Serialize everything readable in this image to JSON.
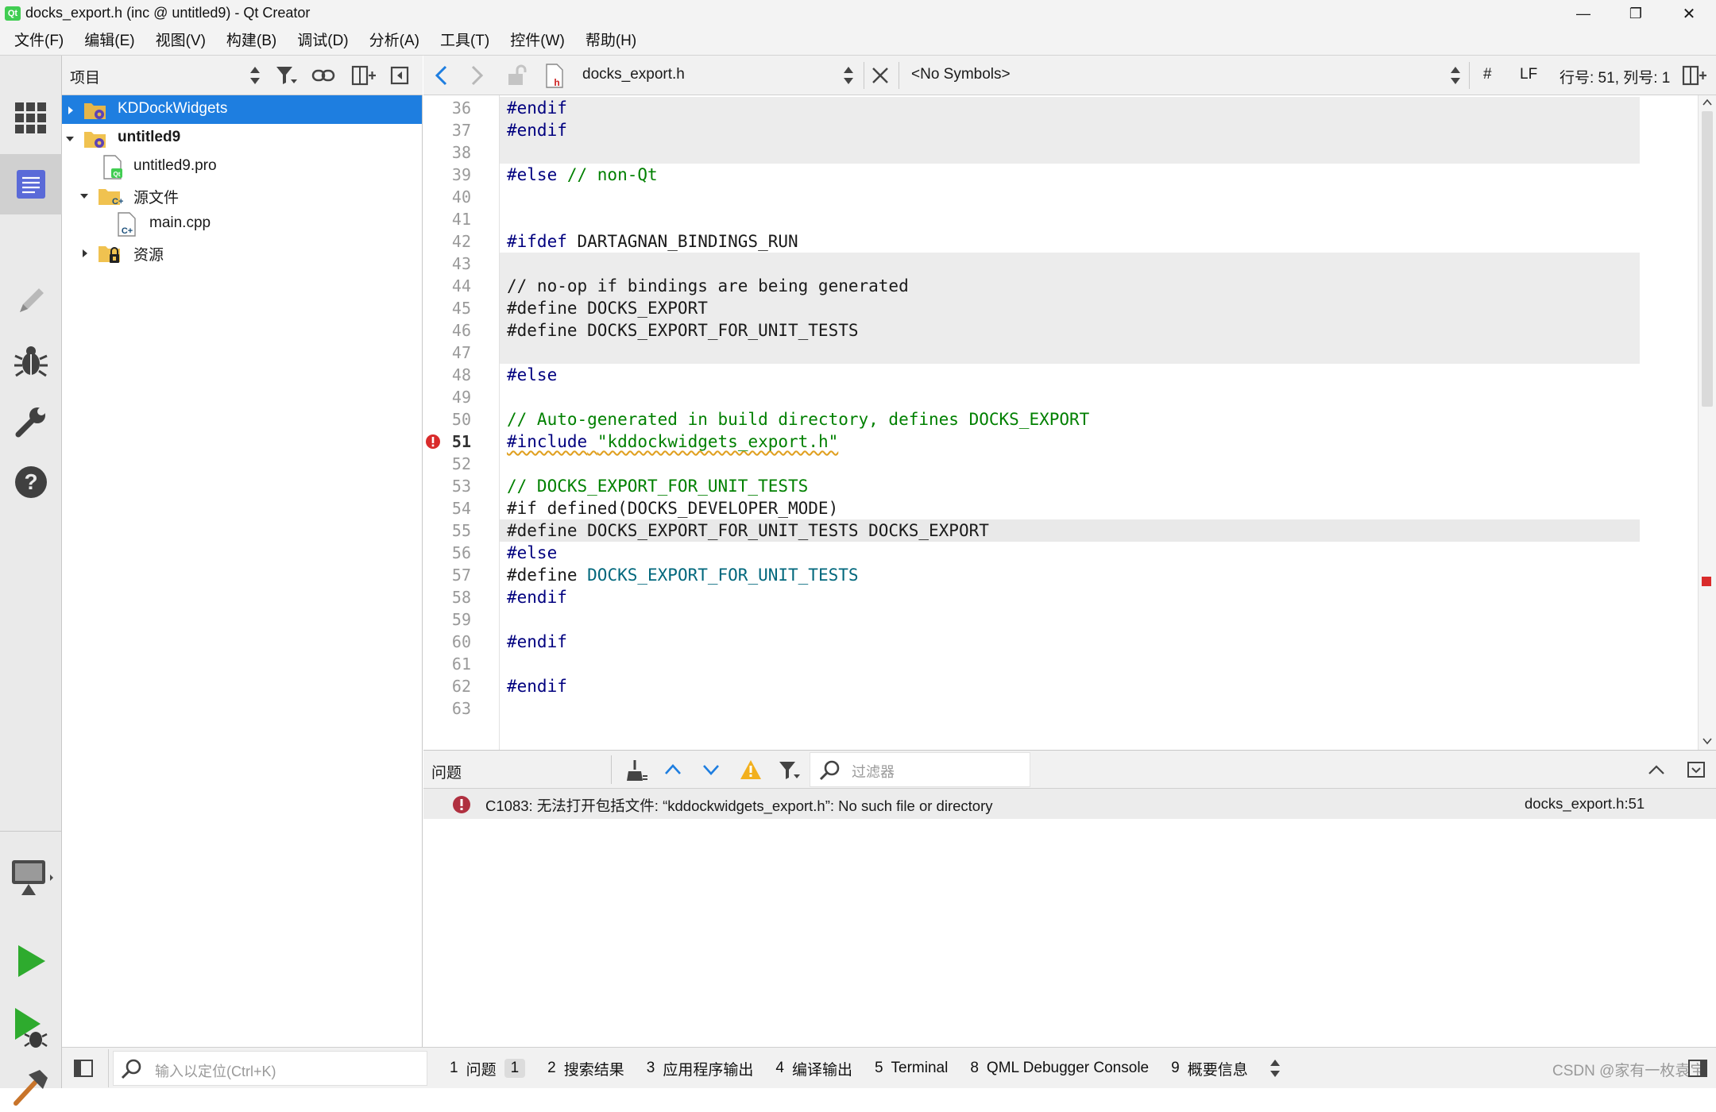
{
  "window": {
    "title": "docks_export.h (inc @ untitled9) - Qt Creator",
    "controls": {
      "minimize": "—",
      "maximize": "❐",
      "close": "✕"
    }
  },
  "menu": [
    "文件(F)",
    "编辑(E)",
    "视图(V)",
    "构建(B)",
    "调试(D)",
    "分析(A)",
    "工具(T)",
    "控件(W)",
    "帮助(H)"
  ],
  "modes": [
    "welcome-icon",
    "edit-icon",
    "design-icon",
    "debug-icon",
    "projects-icon",
    "help-icon"
  ],
  "run_controls": [
    "target-monitor-icon",
    "run-icon",
    "debug-run-icon",
    "build-hammer-icon"
  ],
  "project_pane": {
    "title": "项目",
    "tree": [
      {
        "label": "KDDockWidgets",
        "icon": "project-folder-icon",
        "expanded": false,
        "selected": true,
        "bold": false
      },
      {
        "label": "untitled9",
        "icon": "project-folder-icon",
        "expanded": true,
        "selected": false,
        "bold": true
      },
      {
        "label": "untitled9.pro",
        "icon": "pro-file-icon"
      },
      {
        "label": "源文件",
        "icon": "source-folder-icon",
        "expanded": true
      },
      {
        "label": "main.cpp",
        "icon": "cpp-file-icon"
      },
      {
        "label": "资源",
        "icon": "resource-folder-icon",
        "expanded": false
      }
    ]
  },
  "editor_toolbar": {
    "file_name": "docks_export.h",
    "symbols": "<No Symbols>",
    "hash": "#",
    "line_ending": "LF",
    "position": "行号: 51, 列号: 1"
  },
  "code_lines": [
    {
      "n": "36",
      "text": "#endif",
      "kind": "pp",
      "bg": "grey"
    },
    {
      "n": "37",
      "text": "#endif",
      "kind": "pp",
      "bg": "grey"
    },
    {
      "n": "38",
      "text": "",
      "kind": "plain",
      "bg": "grey"
    },
    {
      "n": "39",
      "text": "#else // non-Qt",
      "kind": "else-comment",
      "bg": "white"
    },
    {
      "n": "40",
      "text": "",
      "kind": "plain",
      "bg": "white"
    },
    {
      "n": "41",
      "text": "",
      "kind": "plain",
      "bg": "white"
    },
    {
      "n": "42",
      "text": "#ifdef DARTAGNAN_BINDINGS_RUN",
      "kind": "pp-mixed",
      "bg": "white"
    },
    {
      "n": "43",
      "text": "",
      "kind": "plain",
      "bg": "grey"
    },
    {
      "n": "44",
      "text": "// no-op if bindings are being generated",
      "kind": "plain",
      "bg": "grey"
    },
    {
      "n": "45",
      "text": "#define DOCKS_EXPORT",
      "kind": "plain",
      "bg": "grey"
    },
    {
      "n": "46",
      "text": "#define DOCKS_EXPORT_FOR_UNIT_TESTS",
      "kind": "plain",
      "bg": "grey"
    },
    {
      "n": "47",
      "text": "",
      "kind": "plain",
      "bg": "grey"
    },
    {
      "n": "48",
      "text": "#else",
      "kind": "pp",
      "bg": "white"
    },
    {
      "n": "49",
      "text": "",
      "kind": "plain",
      "bg": "white"
    },
    {
      "n": "50",
      "text": "// Auto-generated in build directory, defines DOCKS_EXPORT",
      "kind": "comment",
      "bg": "white"
    },
    {
      "n": "51",
      "text": "#include \"kddockwidgets_export.h\"",
      "kind": "include",
      "bg": "white",
      "error": true
    },
    {
      "n": "52",
      "text": "",
      "kind": "plain",
      "bg": "white"
    },
    {
      "n": "53",
      "text": "// DOCKS_EXPORT_FOR_UNIT_TESTS",
      "kind": "comment",
      "bg": "white"
    },
    {
      "n": "54",
      "text": "#if defined(DOCKS_DEVELOPER_MODE)",
      "kind": "plain",
      "bg": "white"
    },
    {
      "n": "55",
      "text": "#define DOCKS_EXPORT_FOR_UNIT_TESTS DOCKS_EXPORT",
      "kind": "plain",
      "bg": "current"
    },
    {
      "n": "56",
      "text": "#else",
      "kind": "pp",
      "bg": "white"
    },
    {
      "n": "57",
      "text": "#define DOCKS_EXPORT_FOR_UNIT_TESTS",
      "kind": "define-macro",
      "bg": "white"
    },
    {
      "n": "58",
      "text": "#endif",
      "kind": "pp",
      "bg": "white"
    },
    {
      "n": "59",
      "text": "",
      "kind": "plain",
      "bg": "white"
    },
    {
      "n": "60",
      "text": "#endif",
      "kind": "pp",
      "bg": "white"
    },
    {
      "n": "61",
      "text": "",
      "kind": "plain",
      "bg": "white"
    },
    {
      "n": "62",
      "text": "#endif",
      "kind": "pp",
      "bg": "white"
    },
    {
      "n": "63",
      "text": "",
      "kind": "plain",
      "bg": "white"
    }
  ],
  "issues_pane": {
    "title": "问题",
    "filter_placeholder": "过滤器",
    "items": [
      {
        "message": "C1083: 无法打开包括文件: “kddockwidgets_export.h”: No such file or directory",
        "location": "docks_export.h:51"
      }
    ]
  },
  "bottom_bar": {
    "locator_placeholder": "输入以定位(Ctrl+K)",
    "tabs": [
      {
        "num": "1",
        "label": "问题",
        "badge": "1"
      },
      {
        "num": "2",
        "label": "搜索结果"
      },
      {
        "num": "3",
        "label": "应用程序输出"
      },
      {
        "num": "4",
        "label": "编译输出"
      },
      {
        "num": "5",
        "label": "Terminal"
      },
      {
        "num": "8",
        "label": "QML Debugger Console"
      },
      {
        "num": "9",
        "label": "概要信息"
      }
    ],
    "watermark": "CSDN @家有一枚袁宝"
  },
  "colors": {
    "selection": "#1e7ee0",
    "preprocessor": "#00007f",
    "comment": "#008000",
    "macro": "#00677c",
    "error": "#d92b2b",
    "run_green": "#2eab2e"
  }
}
